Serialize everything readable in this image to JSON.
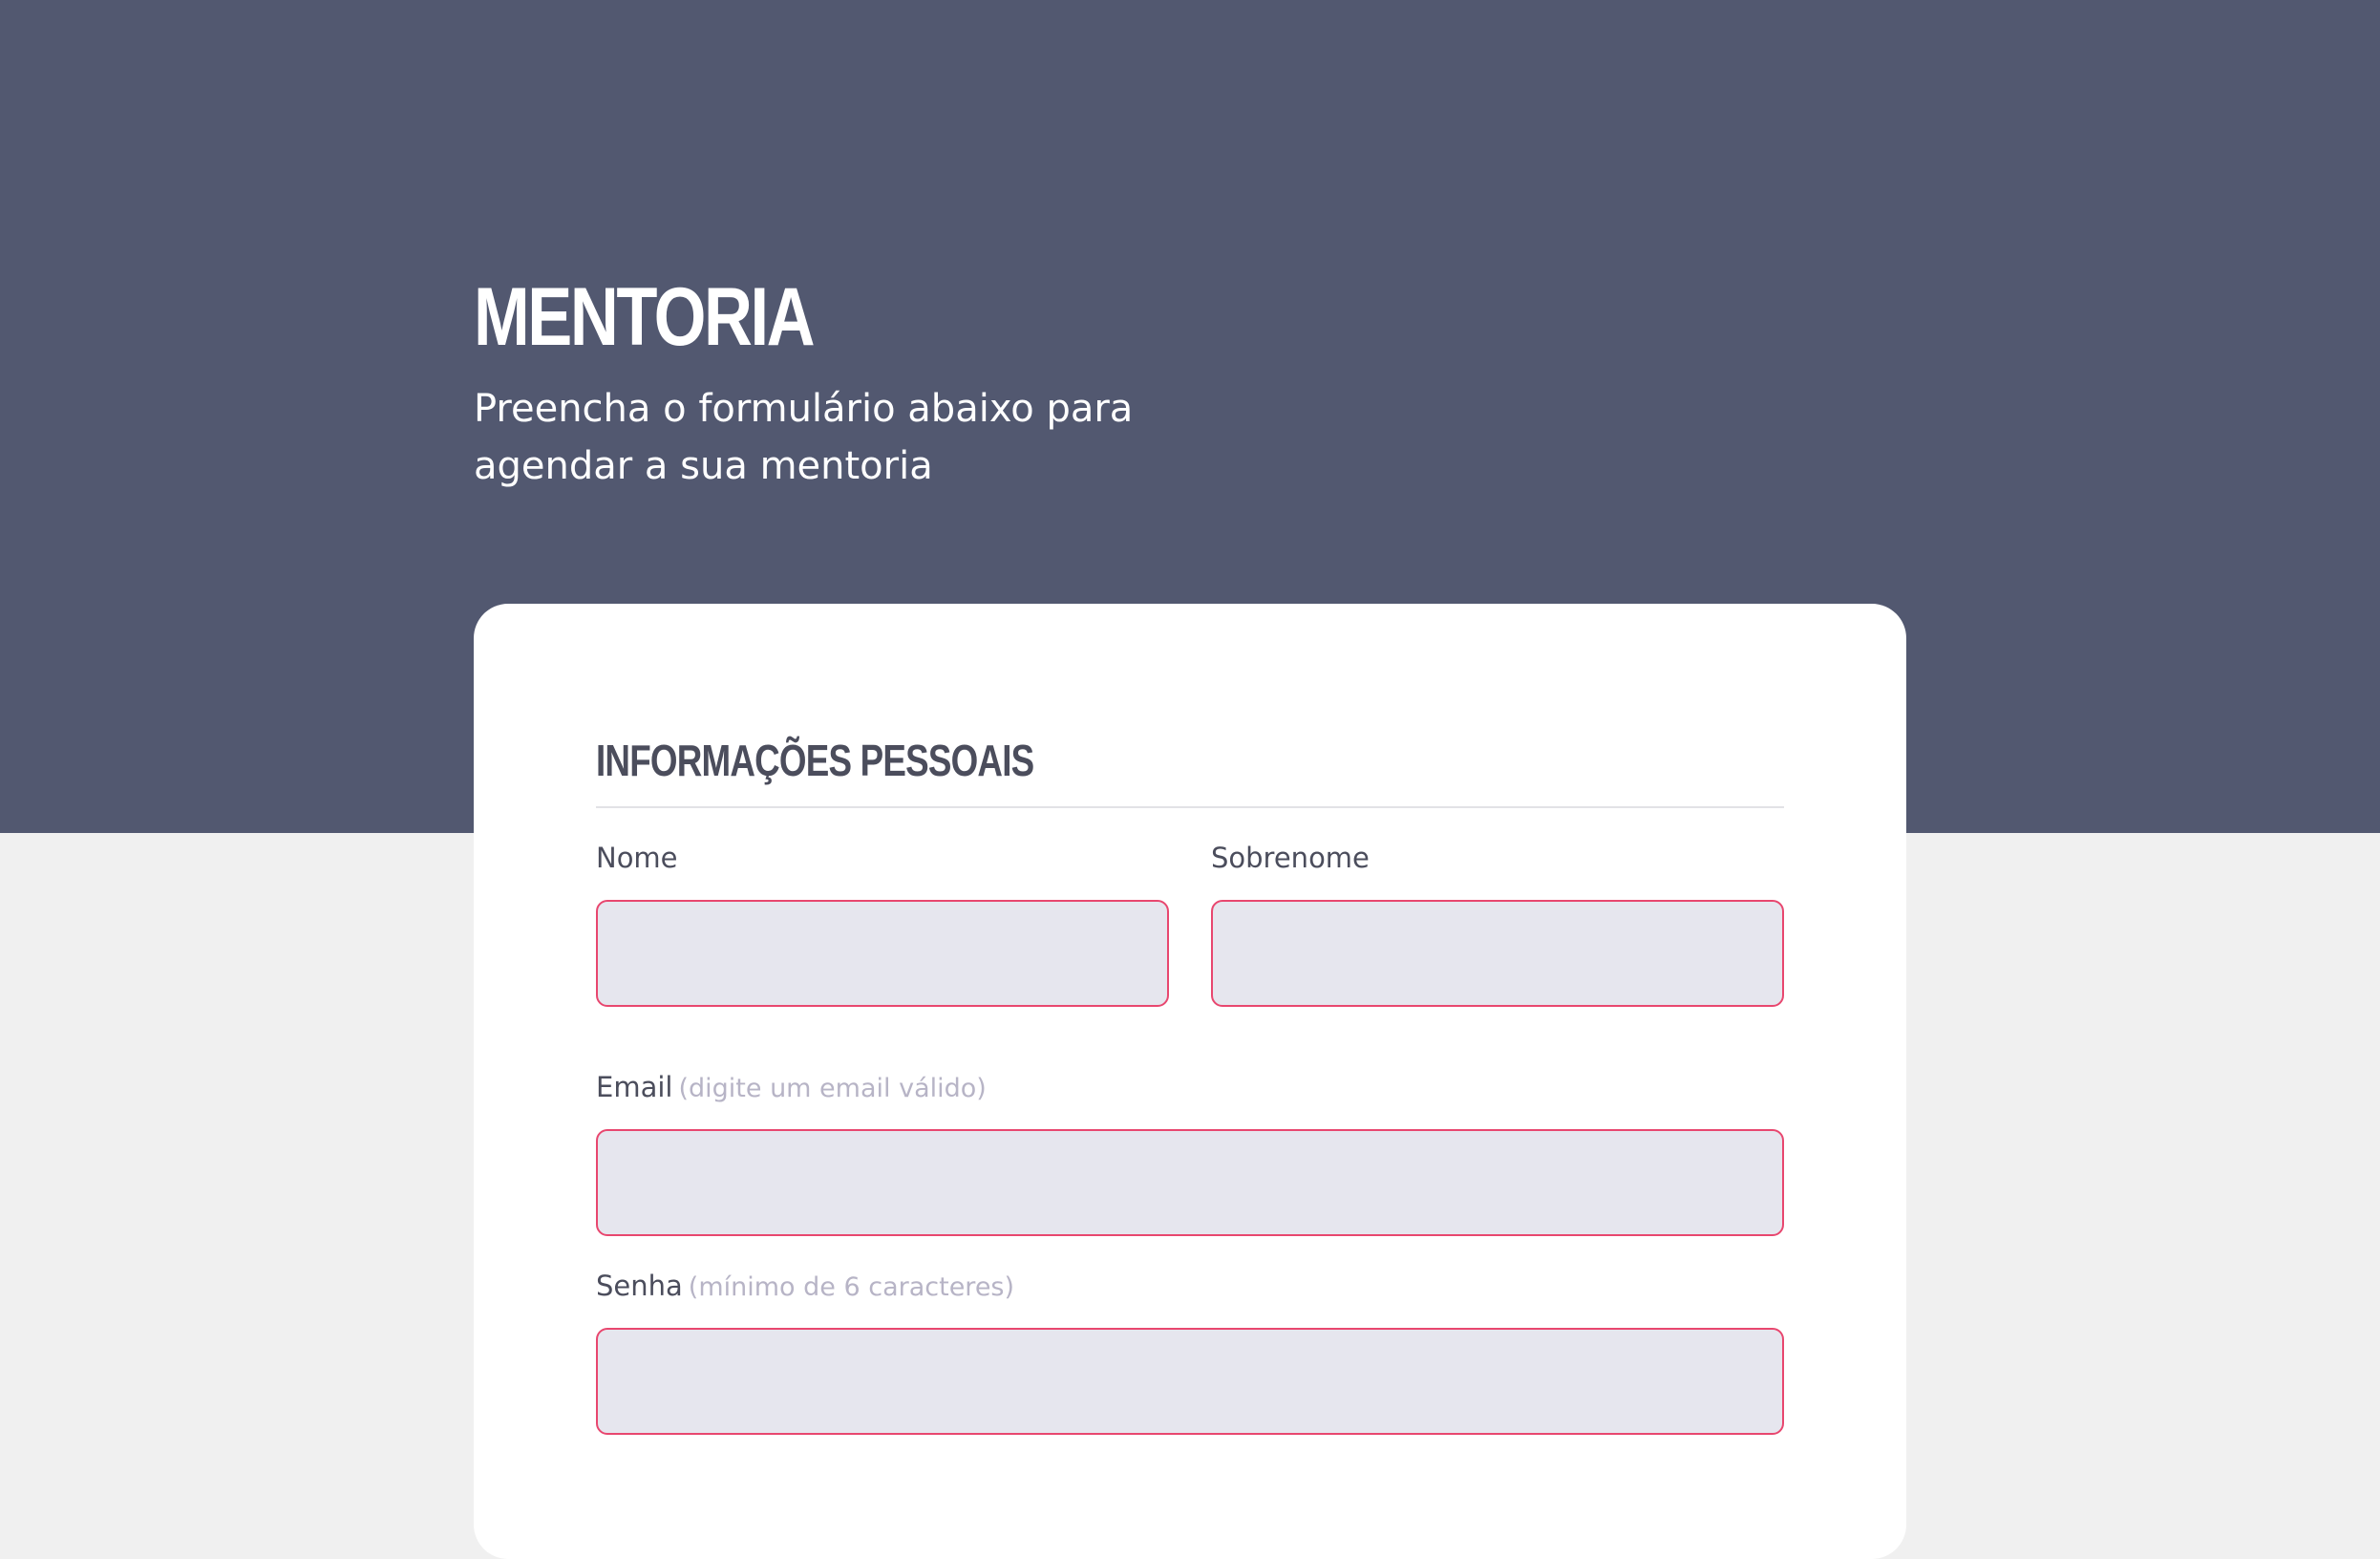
{
  "hero": {
    "title": "MENTORIA",
    "subtitle": "Preencha o formulário abaixo para agendar a sua mentoria"
  },
  "form": {
    "section_title": "INFORMAÇÕES PESSOAIS",
    "fields": {
      "first_name": {
        "label": "Nome",
        "value": ""
      },
      "last_name": {
        "label": "Sobrenome",
        "value": ""
      },
      "email": {
        "label": "Email",
        "hint": "(digite um email válido)",
        "value": ""
      },
      "password": {
        "label": "Senha",
        "hint": "(mínimo de 6 caracteres)",
        "value": ""
      }
    }
  },
  "colors": {
    "hero_background": "#525870",
    "page_background": "#f0f0f0",
    "card_background": "#ffffff",
    "input_background": "#e6e6ee",
    "input_border_invalid": "#e8476f",
    "label_text": "#4b4d5c",
    "hint_text": "#b7b4c6"
  }
}
